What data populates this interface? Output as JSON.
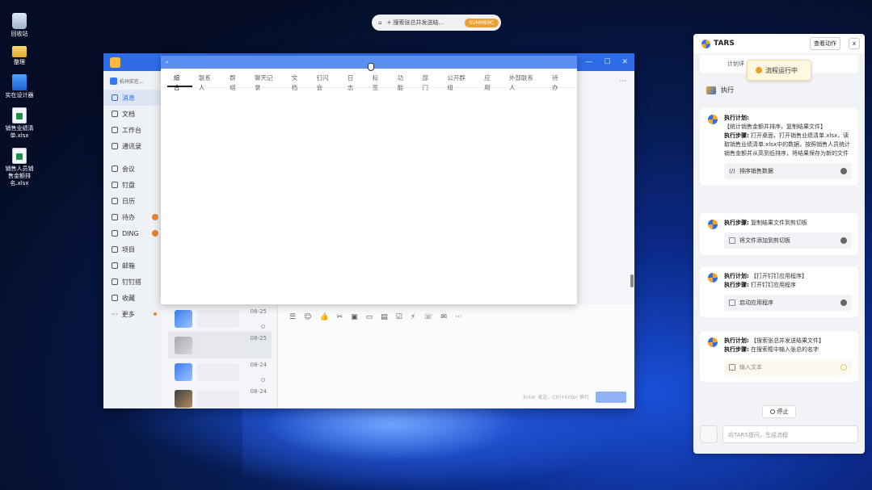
{
  "desktop": {
    "icons": [
      {
        "label": "回收站",
        "kind": "bin"
      },
      {
        "label": "整理",
        "kind": "folder"
      },
      {
        "label": "实在设计器",
        "kind": "app"
      },
      {
        "label": "销售业绩清单.xlsx",
        "kind": "file"
      },
      {
        "label": "销售人员销售金额排名.xlsx",
        "kind": "file"
      }
    ]
  },
  "top_pill": {
    "home_icon": "home-icon",
    "text": "+ 搜索张总并发送结...",
    "button": "SUMMERC"
  },
  "app": {
    "org": "杭州实在...",
    "nav": [
      {
        "label": "消息",
        "active": true
      },
      {
        "label": "文档"
      },
      {
        "label": "工作台"
      },
      {
        "label": "通讯录"
      },
      {
        "label": "会议"
      },
      {
        "label": "钉盘"
      },
      {
        "label": "日历"
      },
      {
        "label": "待办",
        "badge": true
      },
      {
        "label": "DING",
        "badge": true
      },
      {
        "label": "项目"
      },
      {
        "label": "邮箱"
      },
      {
        "label": "钉钉搭"
      },
      {
        "label": "收藏"
      },
      {
        "label": "更多",
        "dot": true
      }
    ],
    "chats": [
      {
        "date": "08-25"
      },
      {
        "date": "08-25"
      },
      {
        "date": "08-24"
      },
      {
        "date": "08-24"
      }
    ],
    "composer_hint": "Enter 发送，Ctrl+Enter 换行",
    "more": "···"
  },
  "search_popup": {
    "tabs": [
      "综合",
      "联系人",
      "群组",
      "聊天记录",
      "文档",
      "钉闪会",
      "日志",
      "标签",
      "功能",
      "部门",
      "公开群组",
      "应用",
      "外部联系人",
      "待办"
    ]
  },
  "tars": {
    "title": "TARS",
    "view_button": "查看动作",
    "close": "x",
    "prev_text": "计划详",
    "running": "流程运行中",
    "exec_label": "执行",
    "cards": [
      {
        "plan_label": "执行计划:",
        "plan": "【统计销售金额并排序，复制结果文件】",
        "steps_label": "执行步骤:",
        "steps": "打开桌面，打开销售业绩清单.xlsx，读取销售业绩清单.xlsx中的数据，按照销售人员统计销售金额并从高到低排序，将结果保存为新的文件",
        "action": "排序销售数据"
      },
      {
        "steps_label": "执行步骤:",
        "steps": "复制结果文件到剪切板",
        "action": "将文件添加到剪切板"
      },
      {
        "plan_label": "执行计划:",
        "plan": "【打开钉钉应用程序】",
        "steps_label": "执行步骤:",
        "steps": "打开钉钉应用程序",
        "action": "启动应用程序"
      },
      {
        "plan_label": "执行计划:",
        "plan": "【搜索张总并发送结果文件】",
        "steps_label": "执行步骤:",
        "steps": "在搜索框中输入张总的名字",
        "action": "输入文本",
        "pending": true
      }
    ],
    "stop": "停止",
    "input_placeholder": "向TARS提问，生成流程"
  }
}
